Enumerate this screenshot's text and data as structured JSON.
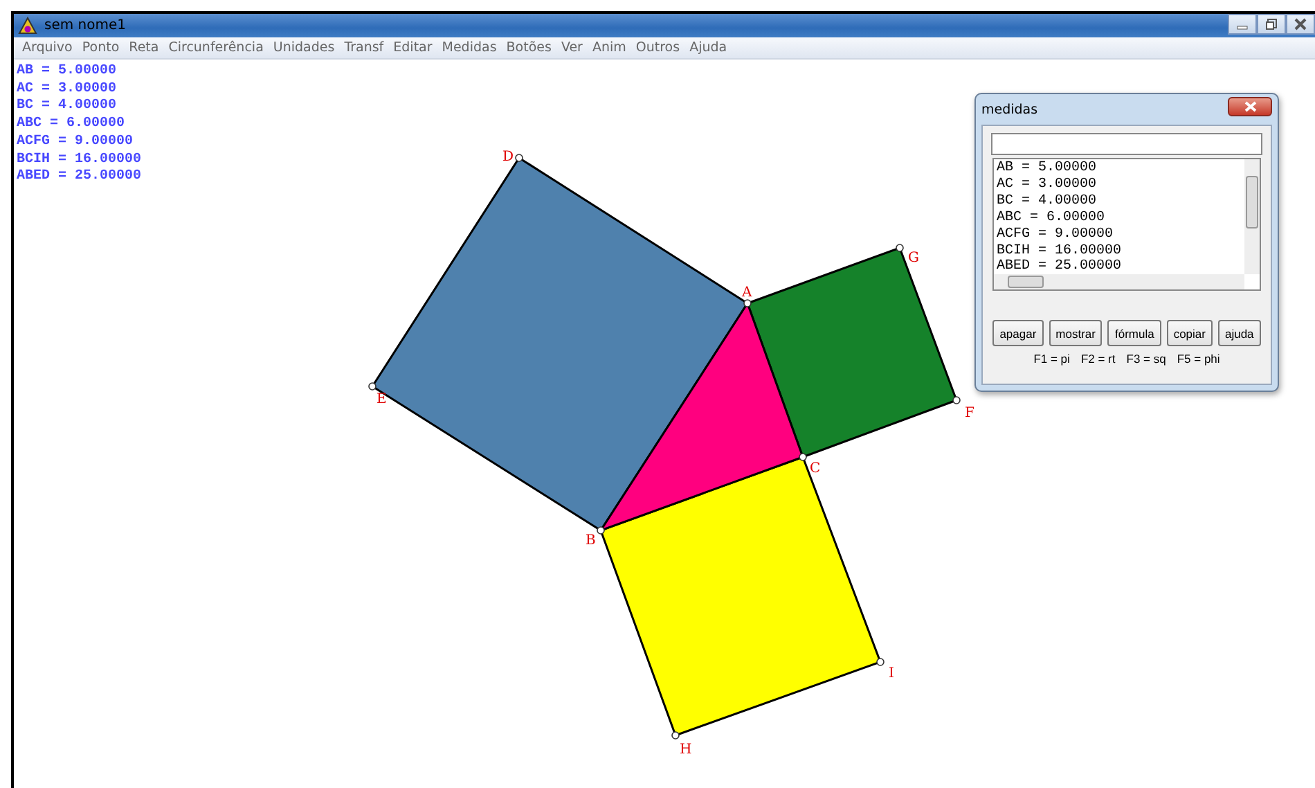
{
  "window": {
    "title": "sem nome1"
  },
  "menu": [
    "Arquivo",
    "Ponto",
    "Reta",
    "Circunferência",
    "Unidades",
    "Transf",
    "Editar",
    "Medidas",
    "Botões",
    "Ver",
    "Anim",
    "Outros",
    "Ajuda"
  ],
  "canvas": {
    "measurements": [
      "AB = 5.00000",
      "AC = 3.00000",
      "BC = 4.00000",
      "ABC = 6.00000",
      "ACFG = 9.00000",
      "BCIH = 16.00000",
      "ABED = 25.00000"
    ],
    "shapes": [
      {
        "kind": "square",
        "color": "#4f81ad"
      },
      {
        "kind": "square",
        "color": "#15822a"
      },
      {
        "kind": "square",
        "color": "#ffff00"
      },
      {
        "kind": "triangle",
        "color": "#ff007f"
      }
    ],
    "points": [
      "A",
      "B",
      "C",
      "D",
      "E",
      "F",
      "G",
      "H",
      "I"
    ]
  },
  "dialog": {
    "title": "medidas",
    "list": [
      "AB = 5.00000",
      "AC = 3.00000",
      "BC = 4.00000",
      "ABC = 6.00000",
      "ACFG = 9.00000",
      "BCIH = 16.00000",
      "ABED = 25.00000"
    ],
    "buttons": [
      "apagar",
      "mostrar",
      "fórmula",
      "copiar",
      "ajuda"
    ],
    "hints": [
      "F1 = pi",
      "F2 = rt",
      "F3 = sq",
      "F5 = phi"
    ]
  }
}
